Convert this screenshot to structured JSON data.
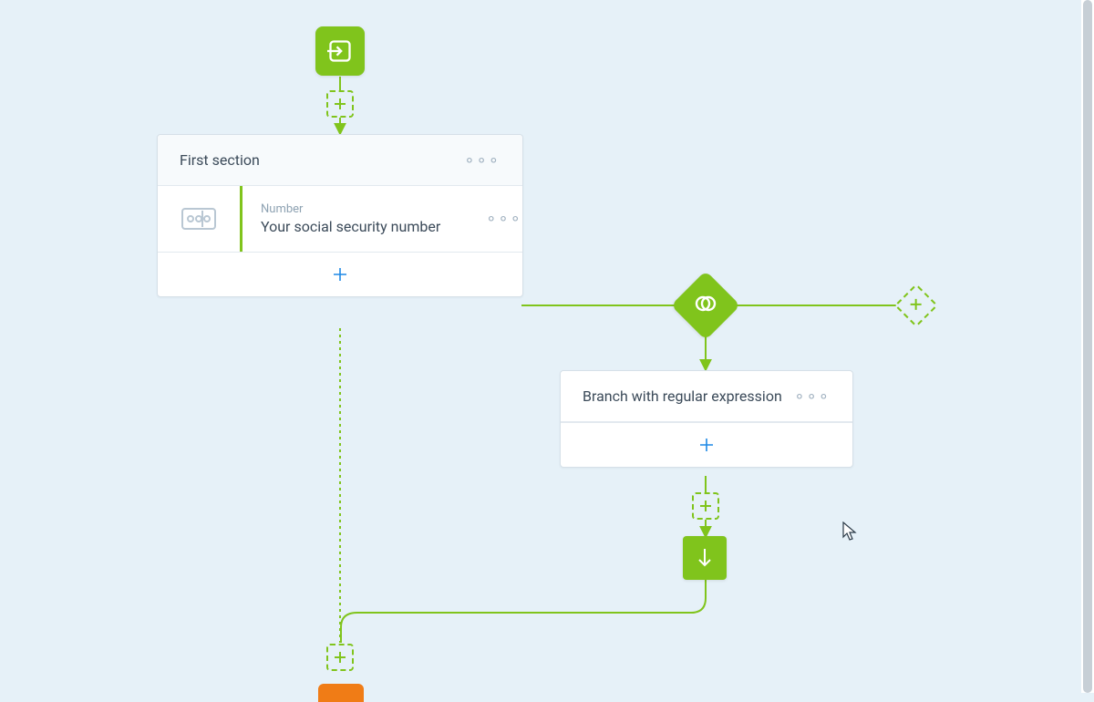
{
  "colors": {
    "green": "#80c41c",
    "blue": "#1e88e5",
    "orange": "#f07c16",
    "bg": "#e6f1f8"
  },
  "start_node": {},
  "section_card": {
    "title": "First section",
    "field_type": "Number",
    "field_label": "Your social security number"
  },
  "branch_card": {
    "title": "Branch with regular expression"
  },
  "icons": {
    "entry": "entry-icon",
    "number": "number-icon",
    "branch": "branch-icon",
    "arrow_down": "arrow-down-icon",
    "plus": "plus-icon"
  }
}
